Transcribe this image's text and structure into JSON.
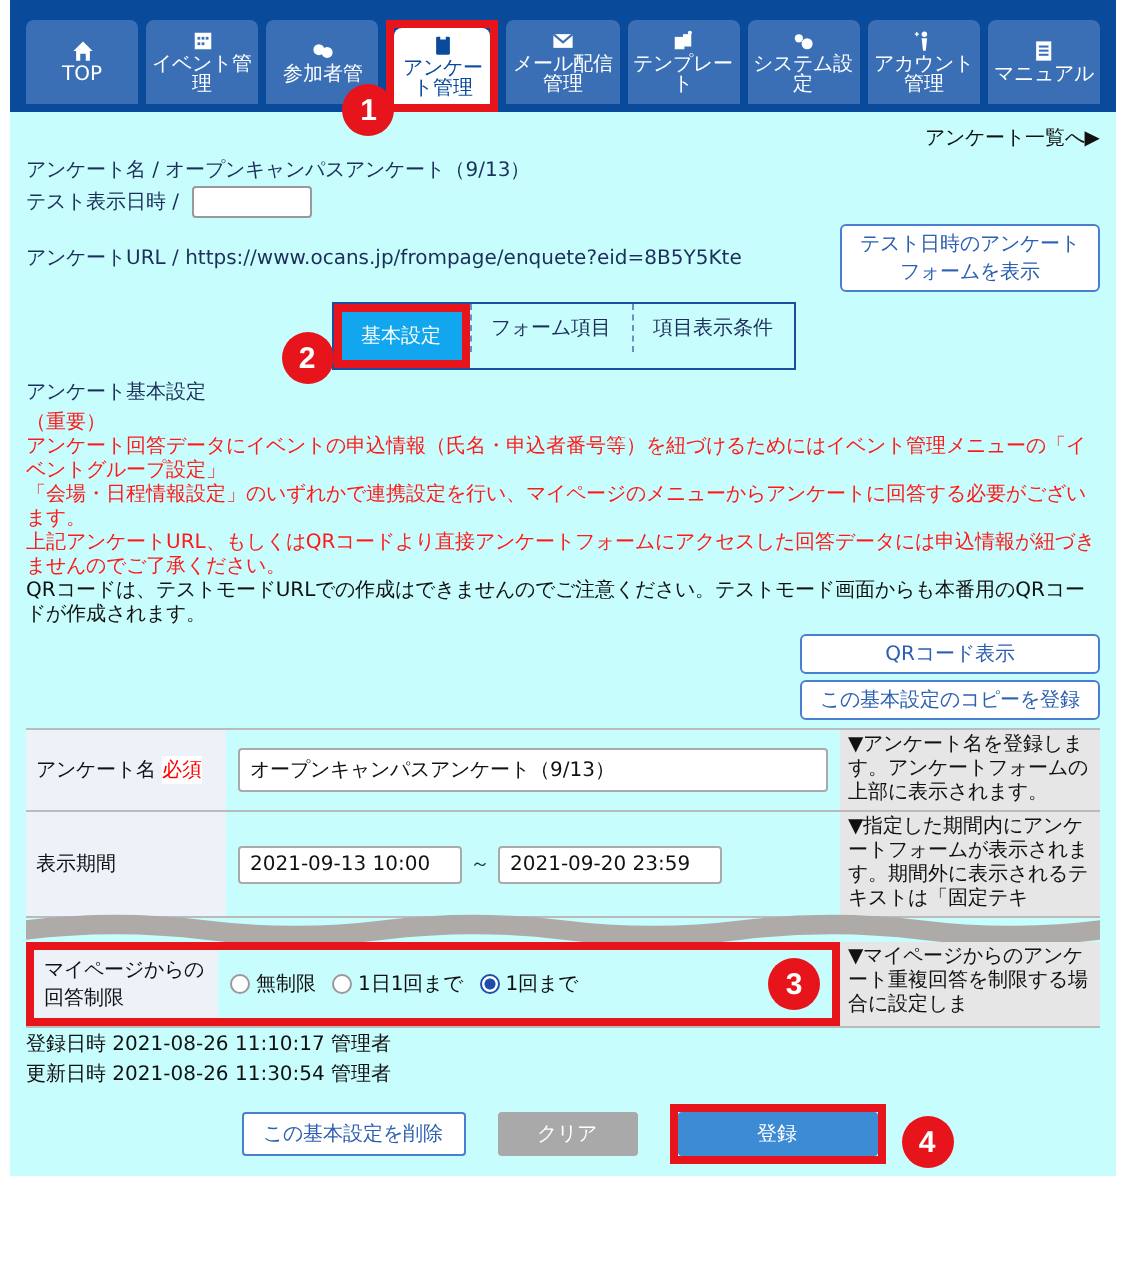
{
  "nav": {
    "tabs": [
      {
        "label": "TOP",
        "selected": false
      },
      {
        "label": "イベント管理",
        "selected": false
      },
      {
        "label": "参加者管",
        "selected": false
      },
      {
        "label": "アンケート管理",
        "selected": true,
        "callout": "1"
      },
      {
        "label": "メール配信管理",
        "selected": false
      },
      {
        "label": "テンプレート",
        "selected": false
      },
      {
        "label": "システム設定",
        "selected": false
      },
      {
        "label": "アカウント管理",
        "selected": false
      },
      {
        "label": "マニュアル",
        "selected": false
      }
    ]
  },
  "list_link": "アンケート一覧へ▶",
  "survey_name": "アンケート名 / オープンキャンパスアンケート（9/13）",
  "test_datetime": {
    "label": "テスト表示日時 /"
  },
  "survey_url": "アンケートURL / https://www.ocans.jp/frompage/enquete?eid=8B5Y5Kte",
  "test_form_button": "テスト日時のアンケートフォームを表示",
  "sub_tabs": [
    {
      "label": "基本設定",
      "selected": true,
      "callout": "2"
    },
    {
      "label": "フォーム項目",
      "selected": false
    },
    {
      "label": "項目表示条件",
      "selected": false
    }
  ],
  "section_title": "アンケート基本設定",
  "notices": [
    {
      "text": "（重要）",
      "important": true
    },
    {
      "text": "アンケート回答データにイベントの申込情報（氏名・申込者番号等）を紐づけるためにはイベント管理メニューの「イベントグループ設定」",
      "important": true
    },
    {
      "text": "「会場・日程情報設定」のいずれかで連携設定を行い、マイページのメニューからアンケートに回答する必要がございます。",
      "important": true
    },
    {
      "text": "上記アンケートURL、もしくはQRコードより直接アンケートフォームにアクセスした回答データには申込情報が紐づきませんのでご了承ください。",
      "important": true
    },
    {
      "text": "QRコードは、テストモードURLでの作成はできませんのでご注意ください。テストモード画面からも本番用のQRコードが作成されます。",
      "important": false
    }
  ],
  "side_buttons": [
    "QRコード表示",
    "この基本設定のコピーを登録"
  ],
  "form_rows": [
    {
      "kind": "text",
      "label": "アンケート名",
      "required": "必須",
      "value": "オープンキャンパスアンケート（9/13）",
      "help": "▼アンケート名を登録します。アンケートフォームの上部に表示されます。"
    },
    {
      "kind": "range",
      "label": "表示期間",
      "from": "2021-09-13 10:00",
      "separator": "～",
      "to": "2021-09-20 23:59",
      "help": "▼指定した期間内にアンケートフォームが表示されます。期間外に表示されるテキストは「固定テキ"
    },
    {
      "kind": "radio",
      "label": "マイページからの回答制限",
      "callout": "3",
      "options": [
        {
          "label": "無制限",
          "selected": false
        },
        {
          "label": "1日1回まで",
          "selected": false
        },
        {
          "label": "1回まで",
          "selected": true
        }
      ],
      "help": "▼マイページからのアンケート重複回答を制限する場合に設定しま"
    }
  ],
  "meta": [
    "登録日時 2021-08-26 11:10:17 管理者",
    "更新日時 2021-08-26 11:30:54 管理者"
  ],
  "actions": [
    {
      "kind": "outline",
      "label": "この基本設定を削除"
    },
    {
      "kind": "disabled",
      "label": "クリア"
    },
    {
      "kind": "primary",
      "label": "登録",
      "callout": "4"
    }
  ]
}
